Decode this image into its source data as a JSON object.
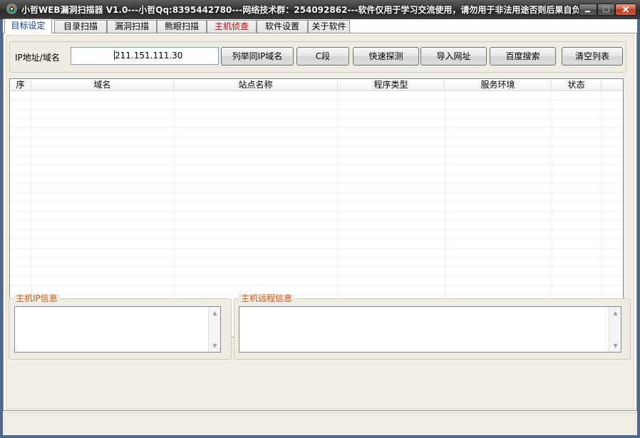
{
  "window": {
    "title": "小哲WEB漏洞扫描器 V1.0---小哲Qq:8395442780---网络技术群：254092862---软件仅用于学习交流使用，请勿用于非法用途否则后果自负"
  },
  "tabs": [
    {
      "label": "目标设定",
      "active": true
    },
    {
      "label": "目录扫描"
    },
    {
      "label": "漏洞扫描"
    },
    {
      "label": "熊眼扫描"
    },
    {
      "label": "主机侦查",
      "color": "#d00000"
    },
    {
      "label": "软件设置"
    },
    {
      "label": "关于软件"
    }
  ],
  "target": {
    "ip_label": "IP地址/域名",
    "ip_value": "211.151.111.30"
  },
  "buttons": {
    "list_same_ip": "列举同IP域名",
    "c_segment": "C段",
    "quick_probe": "快速探测",
    "import_url": "导入网址",
    "baidu_search": "百度搜索",
    "clear_list": "清空列表"
  },
  "table": {
    "columns": [
      "序",
      "域名",
      "站点名称",
      "程序类型",
      "服务环境",
      "状态"
    ],
    "rows": []
  },
  "groups": {
    "host_ip_info": "主机IP信息",
    "host_remote_info": "主机远程信息"
  },
  "colors": {
    "group_title": "#d75a1a",
    "active_tab_text": "#0d3ca8",
    "highlight_tab_text": "#d00000"
  }
}
